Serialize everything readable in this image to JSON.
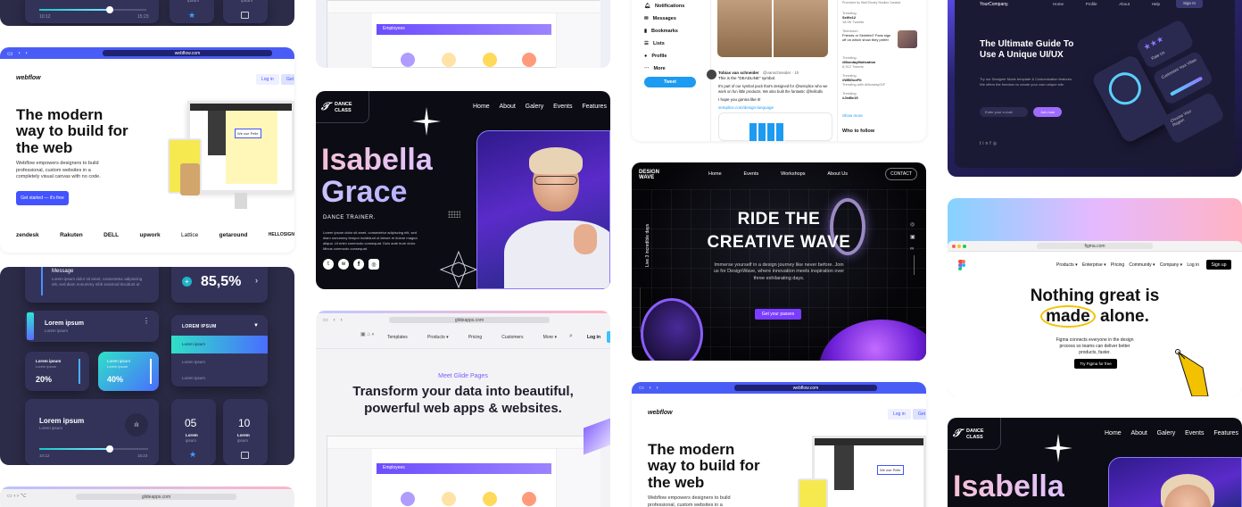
{
  "col1": {
    "top_tile": {
      "time_start": "10:12",
      "time_end": "15:23",
      "label_ipsum": "ipsum"
    },
    "webflow": {
      "url": "webflow.com",
      "logo": "webflow",
      "login": "Log in",
      "get": "Get",
      "headline": "The modern way to build for the web",
      "subtext": "Webflow empowers designers to build professional, custom websites in a completely visual canvas with no code.",
      "cta": "Get started — it's free",
      "logos": [
        "zendesk",
        "Rakuten",
        "DELL",
        "upwork",
        "Lattice",
        "getaround",
        "HELLOSIGN"
      ],
      "mock_field": "We use Pelle"
    },
    "dashboard": {
      "message_title": "Message",
      "message_body": "Lorem ipsum dolor sit amet, consectetur adipiscing elit, sed diam nonummy nibh euismod tincidunt ut",
      "percent": "85,5%",
      "card1_title": "Lorem ipsum",
      "card1_sub": "Lorem ipsum",
      "dropdown_title": "LOREM IPSUM",
      "dropdown_items": [
        "Lorem ipsum",
        "Lorem ipsum",
        "Lorem ipsum"
      ],
      "stat1_label": "Lorem ipsum",
      "stat1_sub": "Lorem ipsum",
      "stat1_value": "20%",
      "stat2_label": "Lorem ipsum",
      "stat2_sub": "Lorem ipsum",
      "stat2_value": "40%",
      "player_title": "Lorem ipsum",
      "player_sub": "Lorem ipsum",
      "time_start": "10:12",
      "time_end": "15:23",
      "num1": "05",
      "num1_l1": "Lorem",
      "num1_l2": "ipsum",
      "num2": "10",
      "num2_l1": "Lorem",
      "num2_l2": "ipsum"
    },
    "bottom_url": "glideapps.com"
  },
  "col2": {
    "top_mock": {
      "banner": "Employees"
    },
    "dance": {
      "logo_line1": "DANCE",
      "logo_line2": "CLASS",
      "nav": [
        "Home",
        "About",
        "Galery",
        "Events",
        "Features"
      ],
      "name_line1": "Isabella",
      "name_line2": "Grace",
      "role": "DANCE TRAINER.",
      "bio": "Lorem ipsum dolor sit amet, consectetur adipiscing elit, sed diam nonummy tempor incididunt ut labore et dolore magna aliqua. Ut enim commodo consequat. Duis aute irure dolor. Minus commodo consequat."
    },
    "glide": {
      "url": "glideapps.com",
      "nav": [
        "Templates",
        "Products ▾",
        "Pricing",
        "Customers",
        "More ▾"
      ],
      "login": "Log in",
      "eyebrow": "Meet Glide Pages",
      "headline": "Transform your data into beautiful, powerful web apps & websites.",
      "banner": "Employees"
    }
  },
  "col3": {
    "twitter": {
      "menu": [
        "Notifications",
        "Messages",
        "Bookmarks",
        "Lists",
        "Profile",
        "More"
      ],
      "tweet_btn": "Tweet",
      "author": "Tobias van schneider",
      "handle": "@vanschneider · 1h",
      "tweet_line1": "This is the \"DEADLINE\" symbol.",
      "tweet_body": "It's part of our symbol pack that's designed for @semplice who we work on fun little products. We also built the fantastic @hellodlx",
      "tweet_line3": "I hope you gonna like it!",
      "tweet_link": "semplice.com/design-language",
      "trends": [
        {
          "cat": "Trending",
          "tag": "Selfie12",
          "count": "18.9K Tweets"
        },
        {
          "cat": "Television",
          "tag": "Friends or Seinfeld? Fans sign off on which show they prefer",
          "count": ""
        },
        {
          "cat": "Trending",
          "tag": "#MondayMotivation",
          "count": "6,912 Tweets"
        },
        {
          "cat": "Trending",
          "tag": "#WBGoeFit",
          "count": "Trending with #MondayGIF"
        },
        {
          "cat": "Trending",
          "tag": "#JinBe15",
          "count": ""
        }
      ],
      "trends_note": "Promoted by Walt Disney Studios Canada",
      "show_more": "Show more",
      "who_to_follow": "Who to follow"
    },
    "designwave": {
      "logo_line1": "DESIGN",
      "logo_line2": "WAVE",
      "nav": [
        "Home",
        "Events",
        "Workshops",
        "About Us"
      ],
      "contact": "CONTACT",
      "side_text": "Live 3 incredible days",
      "headline_line1": "RIDE THE",
      "headline_line2": "CREATIVE WAVE",
      "body": "Immerse yourself in a design journey like never before. Join us for DesignWave, where innovation meets inspiration over three exhilarating days.",
      "cta": "Get your passes"
    },
    "webflow2": {
      "url": "webflow.com",
      "logo": "webflow",
      "login": "Log in",
      "get": "Get",
      "headline": "The modern way to build for the web",
      "subtext": "Webflow empowers designers to build professional, custom websites in a",
      "mock_field": "We use Pelle"
    }
  },
  "col4": {
    "uiux": {
      "company": "YourCompany.",
      "nav": [
        "Home",
        "Profile",
        "About",
        "Help"
      ],
      "signin": "Sign In",
      "headline": "The Ultimate Guide To Use A Unique UI/UX",
      "body": "Try our Designer Mode template & Customization features. We offers the freedom to create your own unique site.",
      "email_placeholder": "Enter your e-mail",
      "join": "Join now",
      "card_rate": "Rate Us",
      "card_customize": "Customize Your Vibes",
      "card_region": "Choose Your Region"
    },
    "figma": {
      "url": "figma.com",
      "nav": [
        "Products ▾",
        "Enterprise ▾",
        "Pricing",
        "Community ▾",
        "Company ▾",
        "Log in"
      ],
      "signup": "Sign up",
      "headline_line1": "Nothing great is",
      "headline_circled": "made",
      "headline_rest": "alone.",
      "body": "Figma connects everyone in the design process so teams can deliver better products, faster.",
      "cta": "Try Figma for free"
    },
    "dance2": {
      "logo_line1": "DANCE",
      "logo_line2": "CLASS",
      "nav": [
        "Home",
        "About",
        "Galery",
        "Events",
        "Features"
      ],
      "name_line1": "Isabella"
    }
  }
}
